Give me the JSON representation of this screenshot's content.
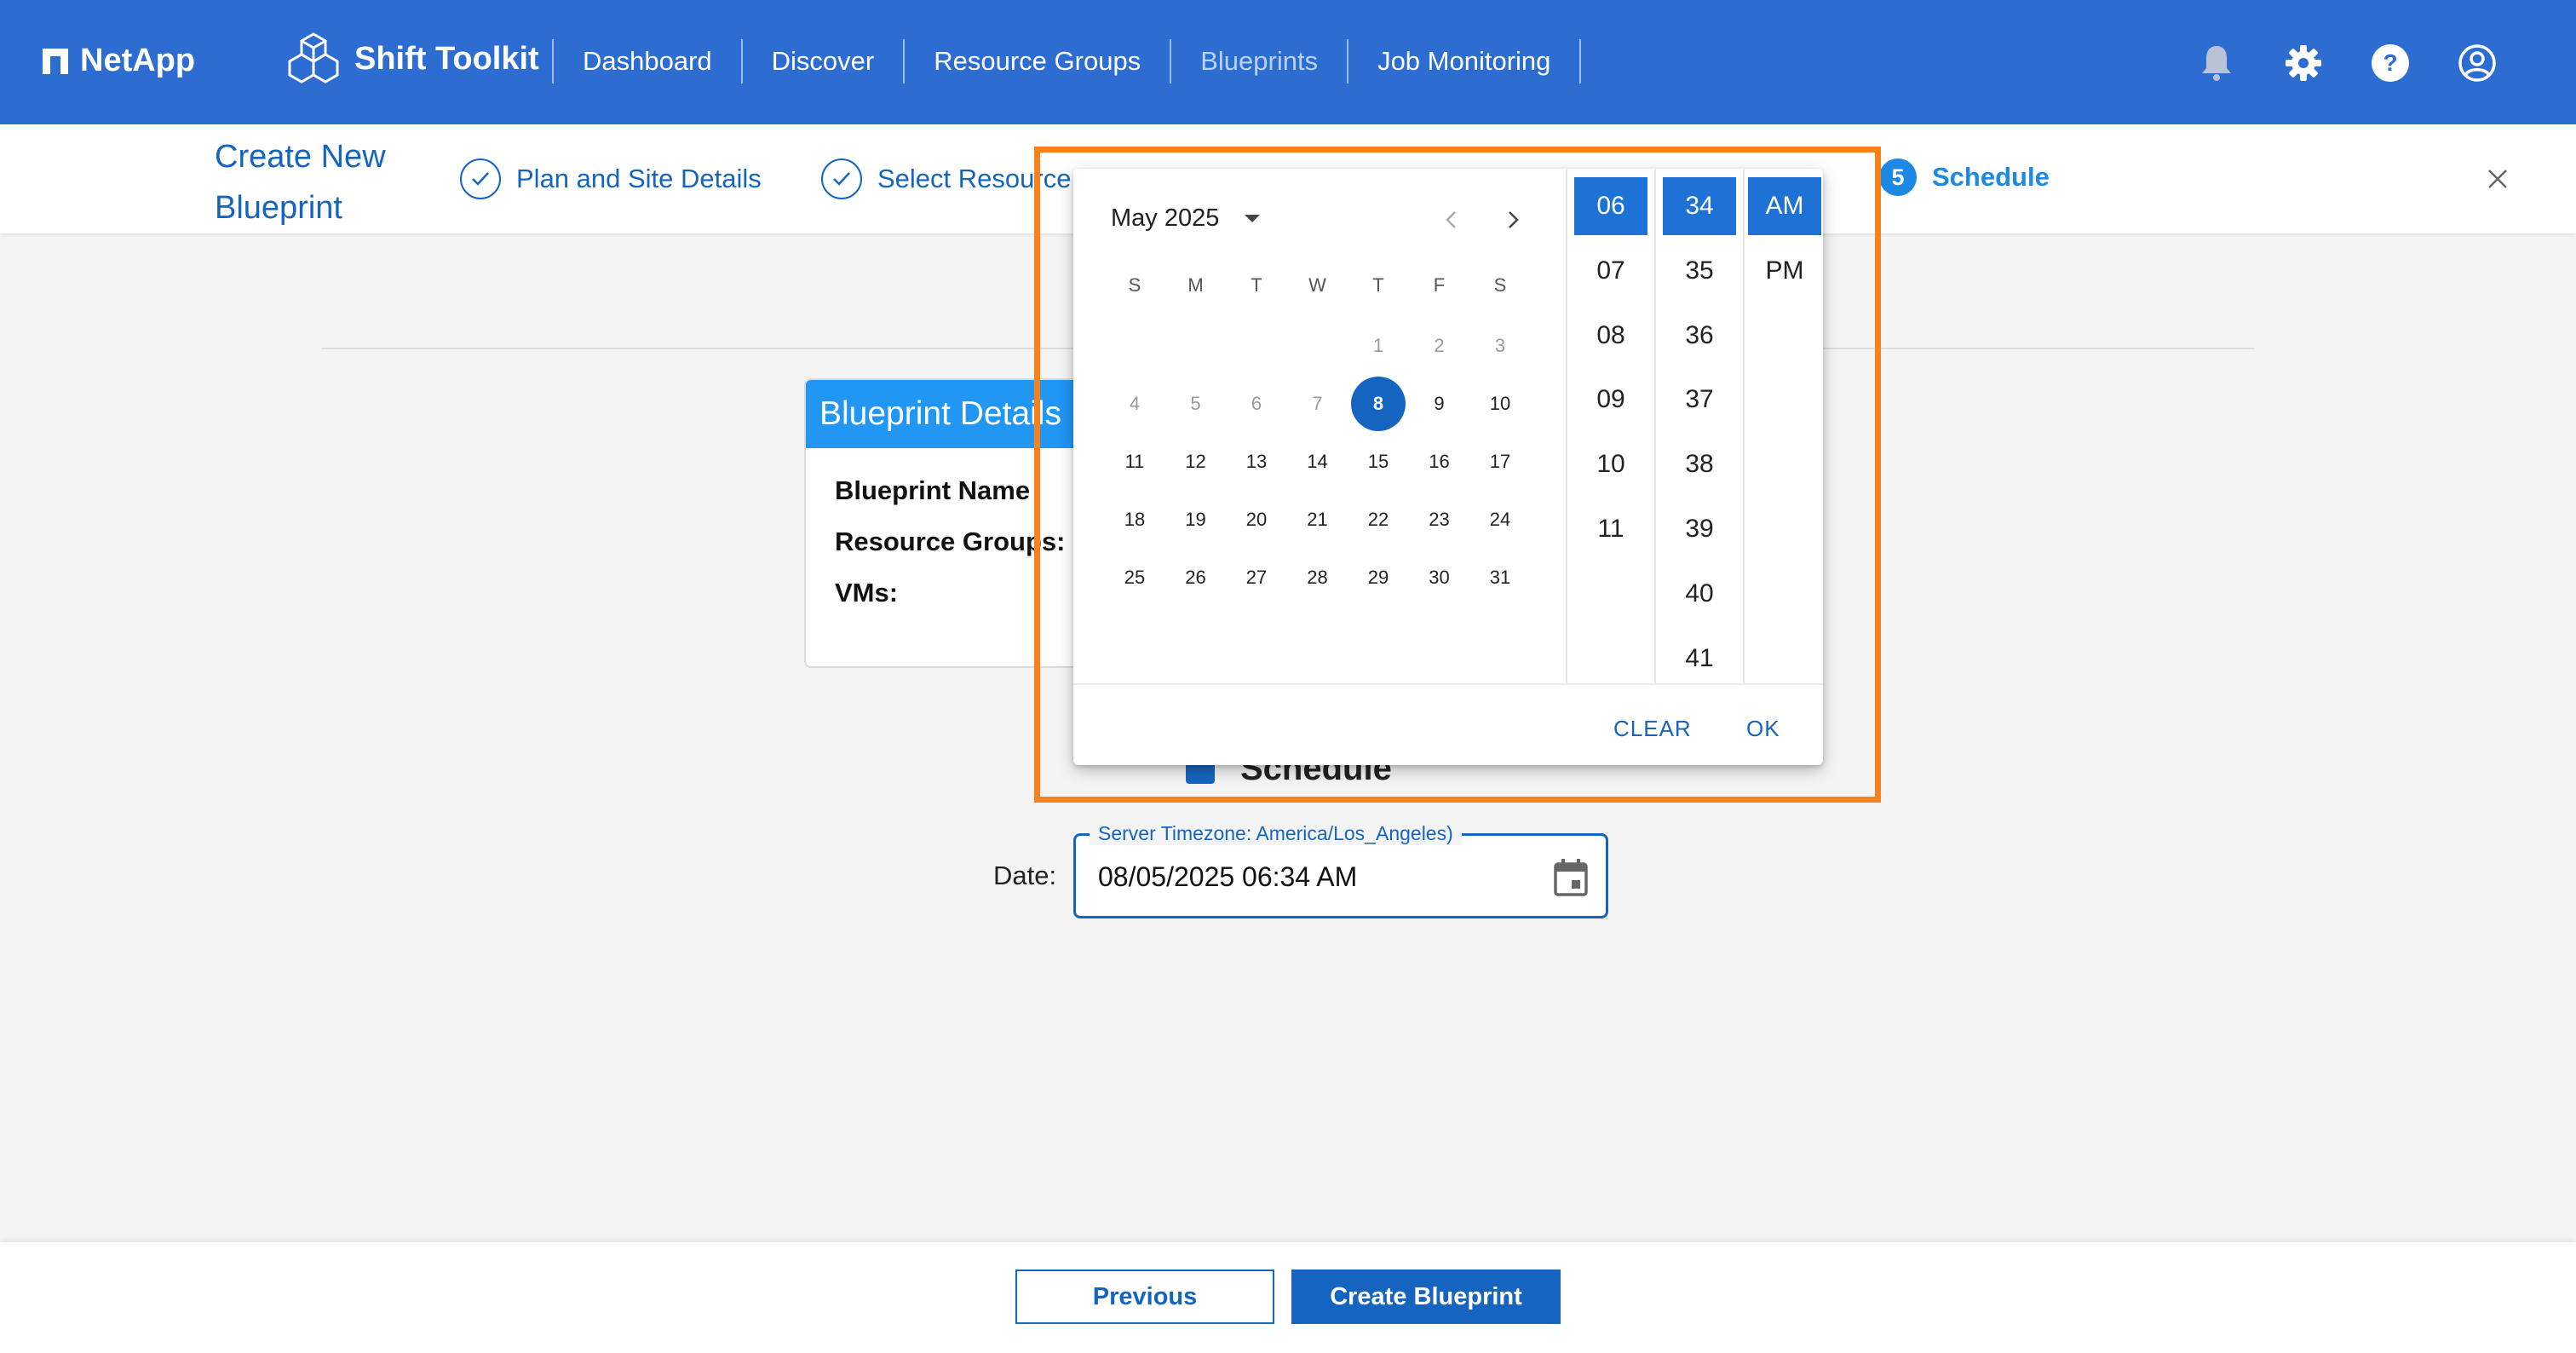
{
  "brand": {
    "name": "NetApp"
  },
  "app": {
    "name": "Shift Toolkit"
  },
  "nav": {
    "items": [
      "Dashboard",
      "Discover",
      "Resource Groups",
      "Blueprints",
      "Job Monitoring"
    ],
    "active": "Blueprints"
  },
  "wizard": {
    "title_line1": "Create New",
    "title_line2": "Blueprint",
    "steps": [
      {
        "label": "Plan and Site Details",
        "state": "done"
      },
      {
        "label": "Select Resource",
        "state": "done"
      },
      {
        "num": "5",
        "label": "Schedule",
        "state": "current"
      }
    ]
  },
  "card": {
    "title": "Blueprint Details",
    "rows": [
      "Blueprint Name",
      "Resource Groups:",
      "VMs:"
    ]
  },
  "schedule": {
    "label": "Schedule",
    "checked": true
  },
  "date": {
    "label": "Date:",
    "legend": "Server Timezone: America/Los_Angeles)",
    "value": "08/05/2025 06:34 AM"
  },
  "picker": {
    "month_label": "May 2025",
    "weekdays": [
      "S",
      "M",
      "T",
      "W",
      "T",
      "F",
      "S"
    ],
    "weeks": [
      [
        "",
        "",
        "",
        "",
        "1",
        "2",
        "3"
      ],
      [
        "4",
        "5",
        "6",
        "7",
        "8",
        "9",
        "10"
      ],
      [
        "11",
        "12",
        "13",
        "14",
        "15",
        "16",
        "17"
      ],
      [
        "18",
        "19",
        "20",
        "21",
        "22",
        "23",
        "24"
      ],
      [
        "25",
        "26",
        "27",
        "28",
        "29",
        "30",
        "31"
      ]
    ],
    "disabled_days": [
      "1",
      "2",
      "3",
      "4",
      "5",
      "6",
      "7"
    ],
    "selected_day": "8",
    "hours": [
      "06",
      "07",
      "08",
      "09",
      "10",
      "11"
    ],
    "selected_hour": "06",
    "minutes": [
      "34",
      "35",
      "36",
      "37",
      "38",
      "39",
      "40",
      "41"
    ],
    "selected_minute": "34",
    "meridiem": [
      "AM",
      "PM"
    ],
    "selected_meridiem": "AM",
    "clear_label": "CLEAR",
    "ok_label": "OK"
  },
  "footer": {
    "previous_label": "Previous",
    "create_label": "Create Blueprint"
  },
  "colors": {
    "header_bg": "#2d6cd0",
    "primary": "#1565c0",
    "accent": "#1e88e5",
    "highlight": "#f7821b"
  }
}
